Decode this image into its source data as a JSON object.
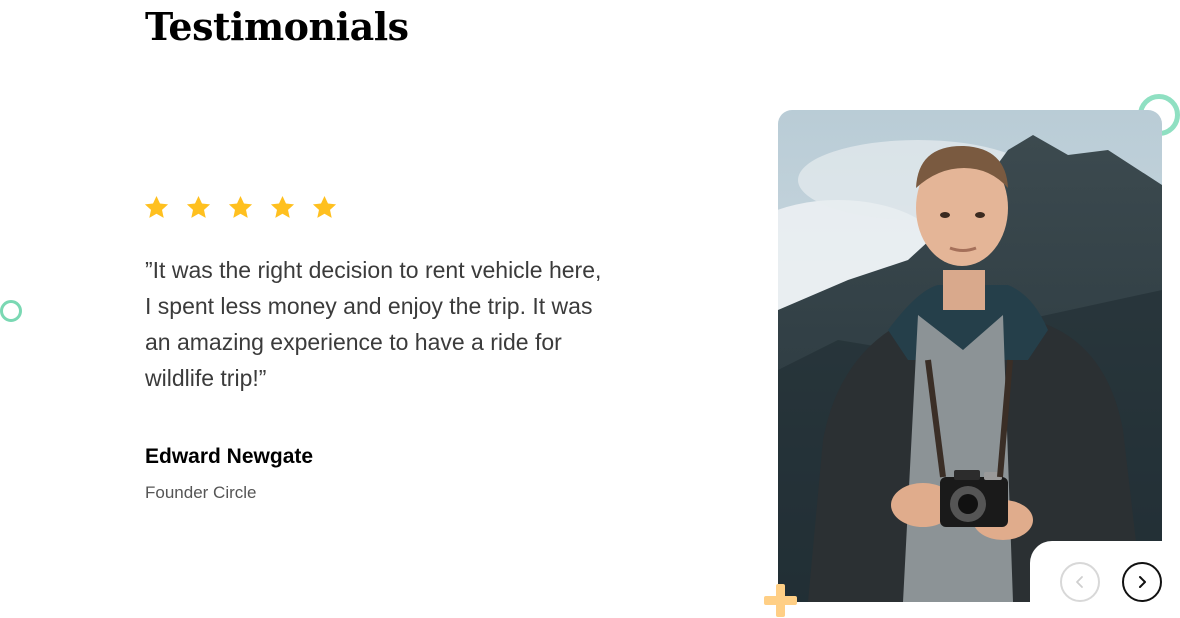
{
  "section": {
    "title": "Testimonials"
  },
  "testimonial": {
    "rating": 5,
    "rating_max": 5,
    "quote": "”It was the right decision to rent vehicle here, I spent less money and enjoy the trip. It was an amazing experience to have a ride for wildlife trip!”",
    "author_name": "Edward Newgate",
    "author_role": "Founder Circle",
    "photo_icon": "person-with-camera-photo"
  },
  "navigation": {
    "prev_icon": "chevron-left-icon",
    "next_icon": "chevron-right-icon"
  },
  "colors": {
    "star": "#FFC01F",
    "accent_ring": "#7AD8B3",
    "plus_deco": "#FFCF85",
    "heading": "#000000",
    "body_text": "#3B3B3B"
  }
}
